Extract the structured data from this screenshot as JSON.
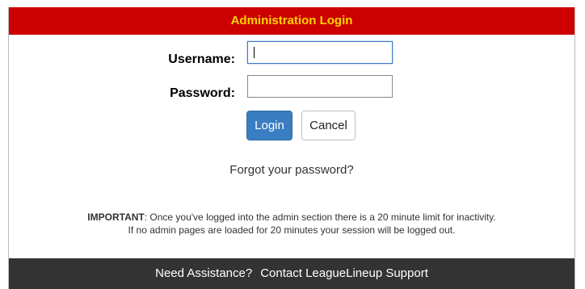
{
  "dialog": {
    "title": "Administration Login"
  },
  "form": {
    "username_label": "Username:",
    "username_value": "",
    "password_label": "Password:",
    "password_value": ""
  },
  "buttons": {
    "login_label": "Login",
    "cancel_label": "Cancel"
  },
  "links": {
    "forgot_password": "Forgot your password?"
  },
  "notice": {
    "important_label": "IMPORTANT",
    "line1_rest": ": Once you've logged into the admin section there is a 20 minute limit for inactivity.",
    "line2": "If no admin pages are loaded for 20 minutes your session will be logged out."
  },
  "footer": {
    "need_assistance": "Need Assistance?",
    "contact_support": "Contact LeagueLineup Support"
  },
  "colors": {
    "title_bar_bg": "#cc0000",
    "title_text": "#ffd400",
    "login_button": "#3a7dc1",
    "footer_bg": "#333333"
  }
}
